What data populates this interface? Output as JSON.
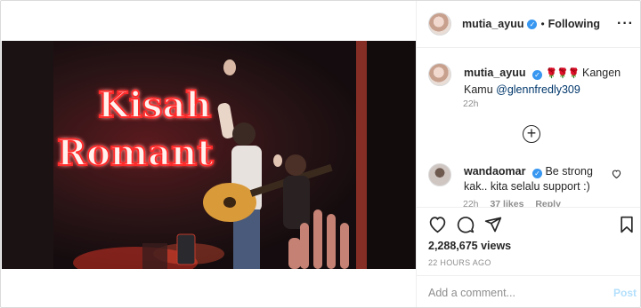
{
  "post": {
    "username": "mutia_ayuu",
    "follow_status": "Following",
    "caption_text": "Kangen Kamu",
    "caption_mention": "@glennfredly309",
    "caption_time": "22h",
    "views": "2,288,675 views",
    "posted_ago": "22 HOURS AGO"
  },
  "media": {
    "sign_line1": "Kisah",
    "sign_line2": "Romant"
  },
  "comment": {
    "username": "wandaomar",
    "text": "Be strong kak.. kita selalu support :)",
    "time": "22h",
    "likes": "37 likes",
    "reply": "Reply"
  },
  "add_comment": {
    "placeholder": "Add a comment...",
    "post_label": "Post"
  },
  "icons": {
    "verified": "verified-badge-icon",
    "more": "more-options-icon",
    "plus": "load-more-comments-icon",
    "heart": "heart-icon",
    "comment": "comment-icon",
    "share": "share-icon",
    "bookmark": "bookmark-icon"
  },
  "colors": {
    "verified_blue": "#3897f0",
    "neon_red": "#ff2b2b",
    "mention": "#00376b",
    "muted": "#8e8e8e"
  }
}
